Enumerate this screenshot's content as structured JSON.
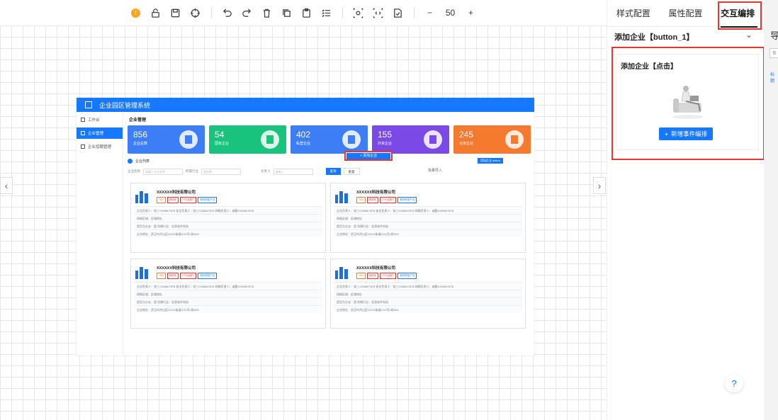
{
  "toolbar": {
    "zoom_value": "50",
    "zoom_minus": "−",
    "zoom_plus": "+",
    "warning_badge": "!"
  },
  "canvas": {
    "prev_arrow": "‹",
    "next_arrow": "›"
  },
  "preview": {
    "app_title": "企业园区管理系统",
    "sidebar": [
      {
        "label": "工作台"
      },
      {
        "label": "企业管理"
      },
      {
        "label": "企业招聘管理"
      }
    ],
    "page_title": "企业管理",
    "stats": [
      {
        "value": "856",
        "label": "企业总数",
        "color": "#3d7ef6"
      },
      {
        "value": "54",
        "label": "国有企业",
        "color": "#19c37d"
      },
      {
        "value": "402",
        "label": "私营企业",
        "color": "#3d7ef6"
      },
      {
        "value": "155",
        "label": "外资企业",
        "color": "#7b4ae6"
      },
      {
        "value": "245",
        "label": "合资企业",
        "color": "#f57a2f"
      }
    ],
    "list_title": "企业列表",
    "selected_tag": "添加企业 button",
    "filter": {
      "name_label": "企业名称",
      "name_placeholder": "请输入企业名称",
      "industry_label": "所属行业",
      "industry_placeholder": "请选择",
      "person_label": "负责人",
      "person_placeholder": "请输入",
      "search_btn": "查询",
      "reset_btn": "重置"
    },
    "add_btn": "+ 添加企业",
    "import_btn": "批量导入",
    "card": {
      "name": "XXXXXX科技有限公司",
      "tags": [
        "TBS",
        "规范化",
        "IT行业部门",
        "软件研发产业"
      ],
      "rows": [
        "企业负责人：张三/13366/7878   安全负责人：张三/13366/7878   网格负责人：戚勤/13366/7878",
        "网格区域：区域地址",
        "是否为分支：是   所属行业：信息软件科技",
        "企业地址：武汉市洪山区XXXX街道XXX号1栋403"
      ]
    }
  },
  "panel": {
    "tabs": [
      "样式配置",
      "属性配置",
      "交互编排"
    ],
    "component_title": "添加企业【button_1】",
    "event_title": "添加企业【点击】",
    "add_event_btn": "新增事件编排",
    "help": "?"
  },
  "far_panel": {
    "title": "导",
    "box": "在",
    "label": "标题"
  }
}
